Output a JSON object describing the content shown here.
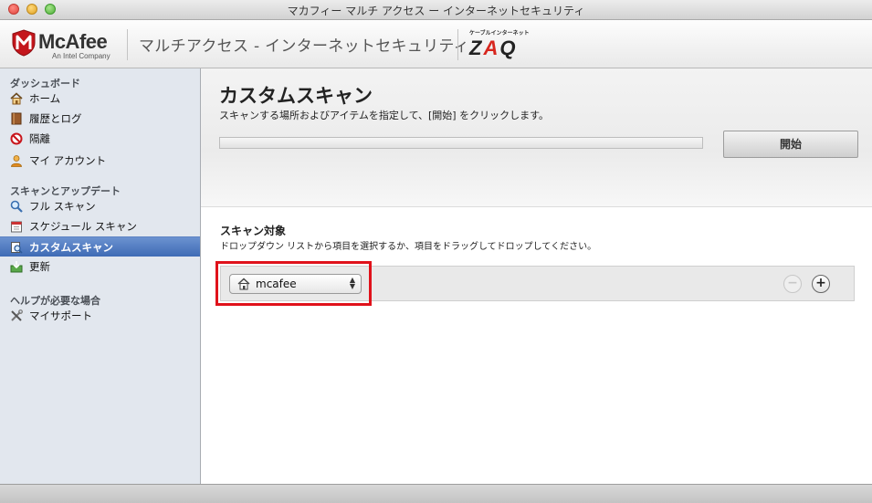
{
  "window": {
    "title": "マカフィー マルチ アクセス ー インターネットセキュリティ"
  },
  "header": {
    "logo_text": "McAfee",
    "logo_sub": "An Intel Company",
    "product_name": "マルチアクセス - インターネットセキュリティ",
    "partner_caption": "ケーブルインターネット",
    "partner_logo": {
      "z": "Z",
      "a": "A",
      "q": "Q"
    }
  },
  "sidebar": {
    "sections": [
      {
        "label": "ダッシュボード",
        "items": [
          {
            "label": "ホーム",
            "icon": "home-icon"
          },
          {
            "label": "履歴とログ",
            "icon": "book-icon"
          },
          {
            "label": "隔離",
            "icon": "prohibited-icon"
          },
          {
            "label": "マイ アカウント",
            "icon": "user-icon"
          }
        ]
      },
      {
        "label": "スキャンとアップデート",
        "items": [
          {
            "label": "フル スキャン",
            "icon": "magnifier-icon"
          },
          {
            "label": "スケジュール スキャン",
            "icon": "calendar-icon"
          },
          {
            "label": "カスタムスキャン",
            "icon": "custom-scan-icon",
            "active": true
          },
          {
            "label": "更新",
            "icon": "download-icon"
          }
        ]
      },
      {
        "label": "ヘルプが必要な場合",
        "items": [
          {
            "label": "マイサポート",
            "icon": "tools-icon"
          }
        ]
      }
    ]
  },
  "main": {
    "title": "カスタムスキャン",
    "description": "スキャンする場所およびアイテムを指定して、[開始] をクリックします。",
    "start_label": "開始",
    "progress": 0,
    "target": {
      "title": "スキャン対象",
      "description": "ドロップダウン リストから項目を選択するか、項目をドラッグしてドロップしてください。",
      "selected": "mcafee",
      "remove_label": "−",
      "add_label": "+"
    }
  },
  "colors": {
    "highlight": "#e0121b",
    "active_item": "#4a76bd",
    "brand_red": "#c4161c"
  }
}
